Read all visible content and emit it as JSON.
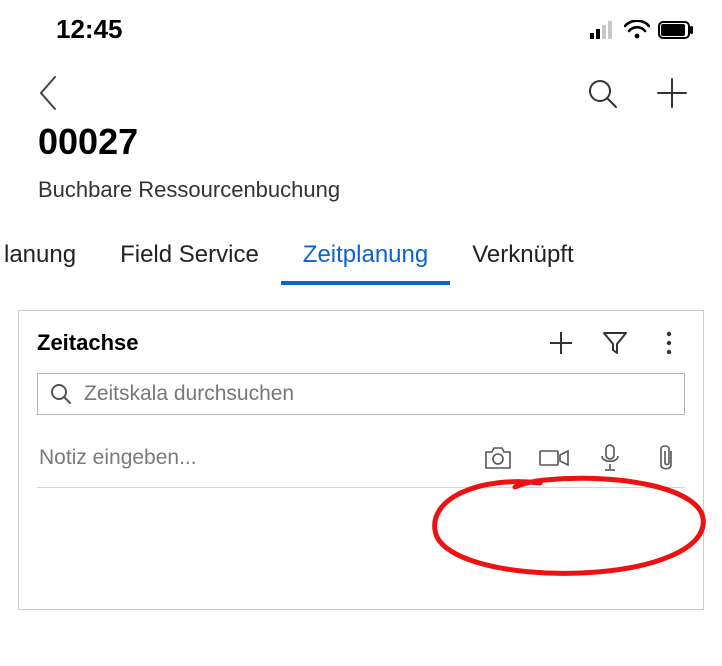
{
  "statusBar": {
    "time": "12:45"
  },
  "header": {
    "title": "00027",
    "subtitle": "Buchbare Ressourcenbuchung"
  },
  "tabs": {
    "items": [
      {
        "label": "lanung"
      },
      {
        "label": "Field Service"
      },
      {
        "label": "Zeitplanung"
      },
      {
        "label": "Verknüpft"
      }
    ],
    "activeIndex": 2
  },
  "timeline": {
    "title": "Zeitachse",
    "searchPlaceholder": "Zeitskala durchsuchen",
    "notePlaceholder": "Notiz eingeben..."
  }
}
